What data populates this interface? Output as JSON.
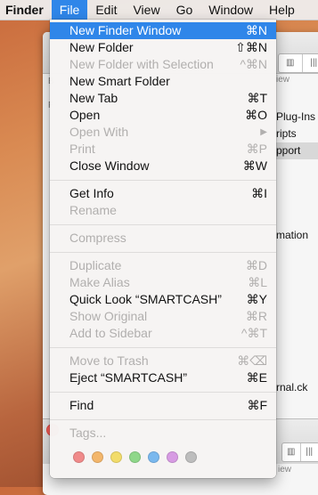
{
  "menubar": {
    "app": "Finder",
    "items": [
      "File",
      "Edit",
      "View",
      "Go",
      "Window",
      "Help"
    ],
    "active": "File"
  },
  "menu": {
    "items": [
      {
        "label": "New Finder Window",
        "shortcut": "⌘N",
        "state": "highlighted"
      },
      {
        "label": "New Folder",
        "shortcut": "⇧⌘N",
        "state": "enabled"
      },
      {
        "label": "New Folder with Selection",
        "shortcut": "^⌘N",
        "state": "disabled"
      },
      {
        "label": "New Smart Folder",
        "shortcut": "",
        "state": "enabled"
      },
      {
        "label": "New Tab",
        "shortcut": "⌘T",
        "state": "enabled"
      },
      {
        "label": "Open",
        "shortcut": "⌘O",
        "state": "enabled"
      },
      {
        "label": "Open With",
        "shortcut": "▶",
        "state": "disabled"
      },
      {
        "label": "Print",
        "shortcut": "⌘P",
        "state": "disabled"
      },
      {
        "label": "Close Window",
        "shortcut": "⌘W",
        "state": "enabled"
      },
      {
        "label": "Get Info",
        "shortcut": "⌘I",
        "state": "enabled"
      },
      {
        "label": "Rename",
        "shortcut": "",
        "state": "disabled"
      },
      {
        "label": "Compress",
        "shortcut": "",
        "state": "disabled"
      },
      {
        "label": "Duplicate",
        "shortcut": "⌘D",
        "state": "disabled"
      },
      {
        "label": "Make Alias",
        "shortcut": "⌘L",
        "state": "disabled"
      },
      {
        "label": "Quick Look “SMARTCASH”",
        "shortcut": "⌘Y",
        "state": "enabled"
      },
      {
        "label": "Show Original",
        "shortcut": "⌘R",
        "state": "disabled"
      },
      {
        "label": "Add to Sidebar",
        "shortcut": "^⌘T",
        "state": "disabled"
      },
      {
        "label": "Move to Trash",
        "shortcut": "⌘⌫",
        "state": "disabled"
      },
      {
        "label": "Eject “SMARTCASH”",
        "shortcut": "⌘E",
        "state": "enabled"
      },
      {
        "label": "Find",
        "shortcut": "⌘F",
        "state": "enabled"
      },
      {
        "label": "Tags...",
        "shortcut": "",
        "state": "disabled"
      }
    ],
    "tags": [
      {
        "name": "red",
        "color": "#f08a8a"
      },
      {
        "name": "orange",
        "color": "#f3b66b"
      },
      {
        "name": "yellow",
        "color": "#f2dc6a"
      },
      {
        "name": "green",
        "color": "#8fd78a"
      },
      {
        "name": "blue",
        "color": "#7ab8ee"
      },
      {
        "name": "purple",
        "color": "#d79be3"
      },
      {
        "name": "gray",
        "color": "#bdbdbd"
      }
    ]
  },
  "background_window": {
    "list_items": [
      "Plug-Ins",
      "ripts",
      "pport",
      "",
      "",
      "",
      "",
      "mation",
      "",
      "",
      "",
      "",
      "",
      "",
      "",
      "",
      "rnal.ck"
    ],
    "view_label": "iew",
    "left_letters": [
      "B",
      "F"
    ],
    "bottom_view_label": "iew",
    "bottom_text": "B"
  }
}
